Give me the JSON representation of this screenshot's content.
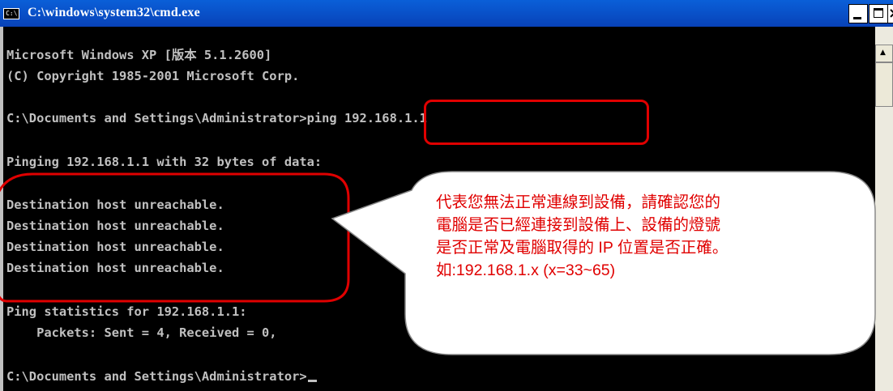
{
  "window": {
    "title": "C:\\windows\\system32\\cmd.exe",
    "icon_glyph": "C:\\",
    "close_glyph": "×"
  },
  "console": {
    "lines": [
      "Microsoft Windows XP [版本 5.1.2600]",
      "(C) Copyright 1985-2001 Microsoft Corp.",
      "",
      "C:\\Documents and Settings\\Administrator>ping 192.168.1.1",
      "",
      "Pinging 192.168.1.1 with 32 bytes of data:",
      "",
      "Destination host unreachable.",
      "Destination host unreachable.",
      "Destination host unreachable.",
      "Destination host unreachable.",
      "",
      "Ping statistics for 192.168.1.1:",
      "    Packets: Sent = 4, Received = 0,",
      "",
      "C:\\Documents and Settings\\Administrator>"
    ]
  },
  "scrollbar": {
    "up_arrow": "▲"
  },
  "annotation": {
    "callout_lines": [
      "代表您無法正常連線到設備，請確認您的",
      "電腦是否已經連接到設備上、設備的燈號",
      "是否正常及電腦取得的 IP 位置是否正確。",
      "如:192.168.1.x (x=33~65)"
    ],
    "color": "#e00000"
  }
}
